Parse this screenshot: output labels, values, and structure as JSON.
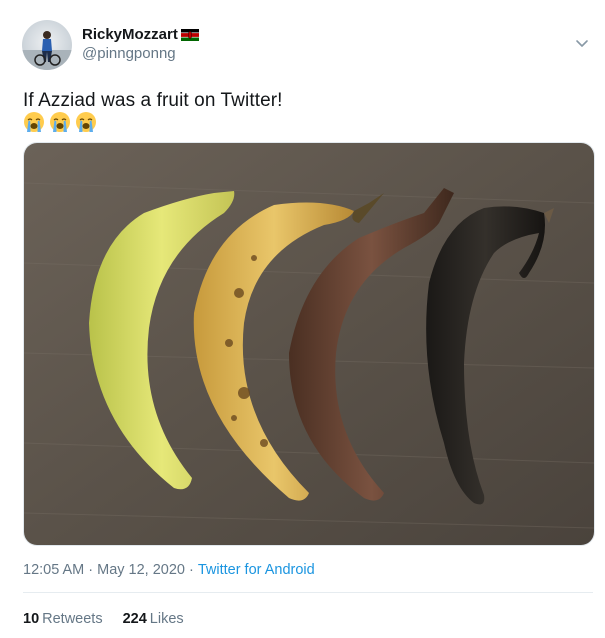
{
  "tweet": {
    "author": {
      "display_name": "RickyMozzart",
      "handle": "@pinngponng",
      "flag_icon": "kenya-flag-icon"
    },
    "text": "If Azziad was a fruit on Twitter!",
    "emojis": [
      "loudly-crying-face-icon",
      "loudly-crying-face-icon",
      "loudly-crying-face-icon"
    ],
    "media_description_icon": "bananas-ripening-photo",
    "time": "12:05 AM",
    "date": "May 12, 2020",
    "separator": "·",
    "source": "Twitter for Android",
    "retweets_count": "10",
    "retweets_label": "Retweets",
    "likes_count": "224",
    "likes_label": "Likes"
  },
  "colors": {
    "link": "#1b95e0",
    "secondary_text": "#657786",
    "primary_text": "#14171a"
  }
}
